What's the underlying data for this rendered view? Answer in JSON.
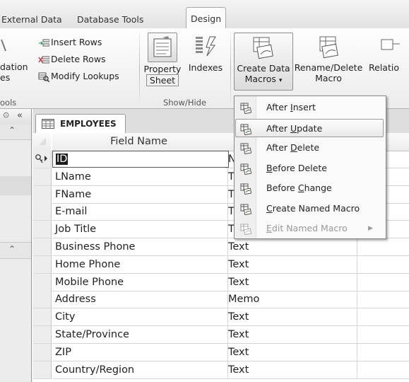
{
  "ribbon_tabs": [
    {
      "label": "External Data"
    },
    {
      "label": "Database Tools"
    },
    {
      "label": "Design"
    }
  ],
  "tools_group": {
    "cut_label": "dation",
    "cut_label2": "es",
    "insert_rows": "Insert Rows",
    "delete_rows": "Delete Rows",
    "modify_lookups": "Modify Lookups",
    "label": "ools"
  },
  "show_hide_group": {
    "property_sheet_line1": "Property",
    "property_sheet_line2": "Sheet",
    "indexes": "Indexes",
    "label": "Show/Hide"
  },
  "field_events_group": {
    "create_data_macros_line1": "Create Data",
    "create_data_macros_line2": "Macros",
    "rename_delete_line1": "Rename/Delete",
    "rename_delete_line2": "Macro",
    "relation_cut": "Relatio"
  },
  "nav_pane": {
    "collapse_glyph": "«"
  },
  "document": {
    "tab_title": "EMPLOYEES"
  },
  "grid": {
    "col_field_name": "Field Name",
    "rows": [
      {
        "name": "ID",
        "type": "N",
        "primary_key": true
      },
      {
        "name": "LName",
        "type": "T"
      },
      {
        "name": "FName",
        "type": "T"
      },
      {
        "name": "E-mail",
        "type": "T"
      },
      {
        "name": "Job Title",
        "type": "T"
      },
      {
        "name": "Business Phone",
        "type": "Text"
      },
      {
        "name": "Home Phone",
        "type": "Text"
      },
      {
        "name": "Mobile Phone",
        "type": "Text"
      },
      {
        "name": "Address",
        "type": "Memo"
      },
      {
        "name": "City",
        "type": "Text"
      },
      {
        "name": "State/Province",
        "type": "Text"
      },
      {
        "name": "ZIP",
        "type": "Text"
      },
      {
        "name": "Country/Region",
        "type": "Text"
      }
    ]
  },
  "menu": {
    "items": [
      {
        "pre": "After ",
        "key": "I",
        "post": "nsert",
        "highlighted": false,
        "disabled": false,
        "icon": "after-insert-icon"
      },
      {
        "pre": "After ",
        "key": "U",
        "post": "pdate",
        "highlighted": true,
        "disabled": false,
        "icon": "after-update-icon"
      },
      {
        "pre": "After ",
        "key": "D",
        "post": "elete",
        "highlighted": false,
        "disabled": false,
        "icon": "after-delete-icon"
      },
      {
        "pre": "",
        "key": "B",
        "post": "efore Delete",
        "highlighted": false,
        "disabled": false,
        "icon": "before-delete-icon"
      },
      {
        "pre": "Before ",
        "key": "C",
        "post": "hange",
        "highlighted": false,
        "disabled": false,
        "icon": "before-change-icon"
      },
      {
        "pre": "",
        "key": "C",
        "post": "reate Named Macro",
        "highlighted": false,
        "disabled": false,
        "icon": "create-named-macro-icon"
      },
      {
        "pre": "",
        "key": "E",
        "post": "dit Named Macro",
        "highlighted": false,
        "disabled": true,
        "icon": "edit-named-macro-icon",
        "submenu": true
      }
    ]
  }
}
